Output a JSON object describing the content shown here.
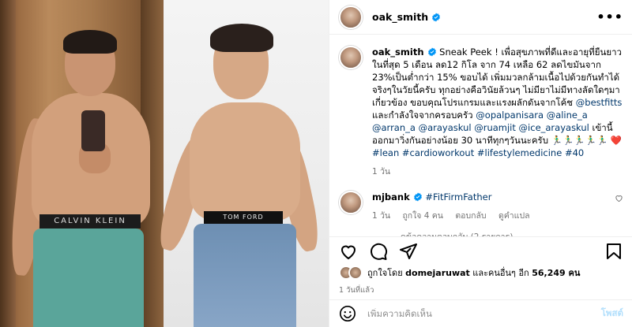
{
  "header": {
    "username": "oak_smith",
    "verified": true,
    "more_label": "•••"
  },
  "post": {
    "left_band_text": "CALVIN KLEIN",
    "right_band_text": "TOM FORD",
    "caption": {
      "username": "oak_smith",
      "text_1": "Sneak Peek ! เพื่อสุขภาพที่ดีและอายุที่ยืนยาว ในที่สุด 5 เดือน ลด12 กิโล จาก 74 เหลือ 62 ลดไขมันจาก 23%เป็นต่ำกว่า 15% ขอบได้ เพิ่มมวลกล้ามเนื้อไปด้วยกันทำได้จริงๆในวัยนี้ครับ ทุกอย่างคือวินัยล้วนๆ ไม่มียาไม่มีทางลัดใดๆมาเกี่ยวข้อง ขอบคุณโปรแกรมและแรงผลักดันจากโค้ช",
      "tag_1": "@bestfitts",
      "text_2": " และกำลังใจจากครอบครัว ",
      "tag_2": "@opalpanisara",
      "tag_3": "@aline_a",
      "tag_4": "@arran_a",
      "tag_5": "@arayaskul",
      "tag_6": "@ruamjit",
      "tag_7": "@ice_arayaskul",
      "text_3": " เข้านี้ออกมาวิ่งกันอย่างน้อย 30 นาทีทุกๆวันนะครับ 🏃‍♂️🏃‍♂️🏃‍♂️🏃‍♂️🏃‍♂️ ❤️",
      "tag_8": "#lean",
      "tag_9": "#cardioworkout",
      "tag_10": "#lifestylemedicine",
      "tag_11": "#40",
      "time": "1 วัน"
    },
    "comment": {
      "username": "mjbank",
      "tag": "#FitFirmFather",
      "time": "1 วัน",
      "likes": "ถูกใจ 4 คน",
      "reply": "ตอบกลับ",
      "translate": "ดูคำแปล",
      "view_replies": "ดูข้อความตอบกลับ (2 รายการ)"
    },
    "likes": {
      "prefix": "ถูกใจโดย ",
      "user": "domejaruwat",
      "middle": " และคนอื่นๆ อีก ",
      "count": "56,249 คน"
    },
    "date": "1 วันที่แล้ว"
  },
  "composer": {
    "placeholder": "เพิ่มความคิดเห็น",
    "post_label": "โพสต์"
  },
  "icons": [
    "emoji-icon",
    "heart-icon",
    "comment-icon",
    "share-icon",
    "bookmark-icon",
    "verified-icon"
  ],
  "colors": {
    "link": "#00376b",
    "verified": "#0095f6",
    "muted": "#737373",
    "post_button": "#b2dffc"
  }
}
